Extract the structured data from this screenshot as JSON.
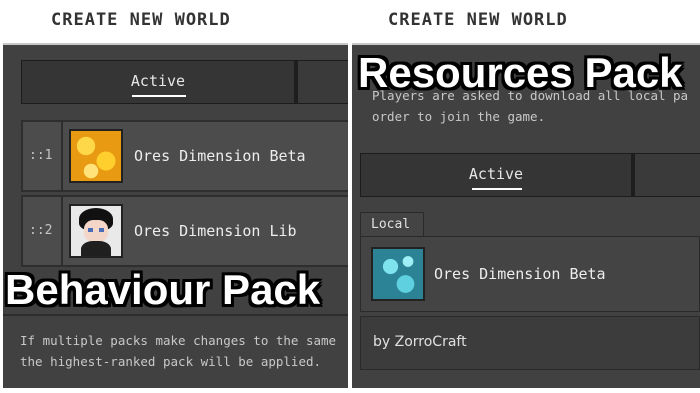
{
  "left": {
    "header_title": "CREATE NEW WORLD",
    "tab_active_label": "Active",
    "packs": [
      {
        "rank": "::1",
        "name": "Ores Dimension Beta",
        "icon": "gold-ore-icon"
      },
      {
        "rank": "::2",
        "name": "Ores Dimension Lib",
        "icon": "avatar-icon"
      }
    ],
    "overlay_caption": "Behaviour Pack",
    "info_line1": "If multiple packs make changes to the same",
    "info_line2": "the highest-ranked pack will be applied."
  },
  "right": {
    "header_title": "CREATE NEW WORLD",
    "overlay_caption": "Resources Pack",
    "info_line1": "Players are asked to download all local pa",
    "info_line2": "order to join the game.",
    "tab_active_label": "Active",
    "local_label": "Local",
    "pack_name": "Ores Dimension Beta",
    "pack_icon": "diamond-ore-icon",
    "author": "by ZorroCraft"
  },
  "colors": {
    "panel_bg": "#414141",
    "header_bg": "#ffffff",
    "caption_fill": "#ffffff",
    "caption_outline": "#000000"
  }
}
